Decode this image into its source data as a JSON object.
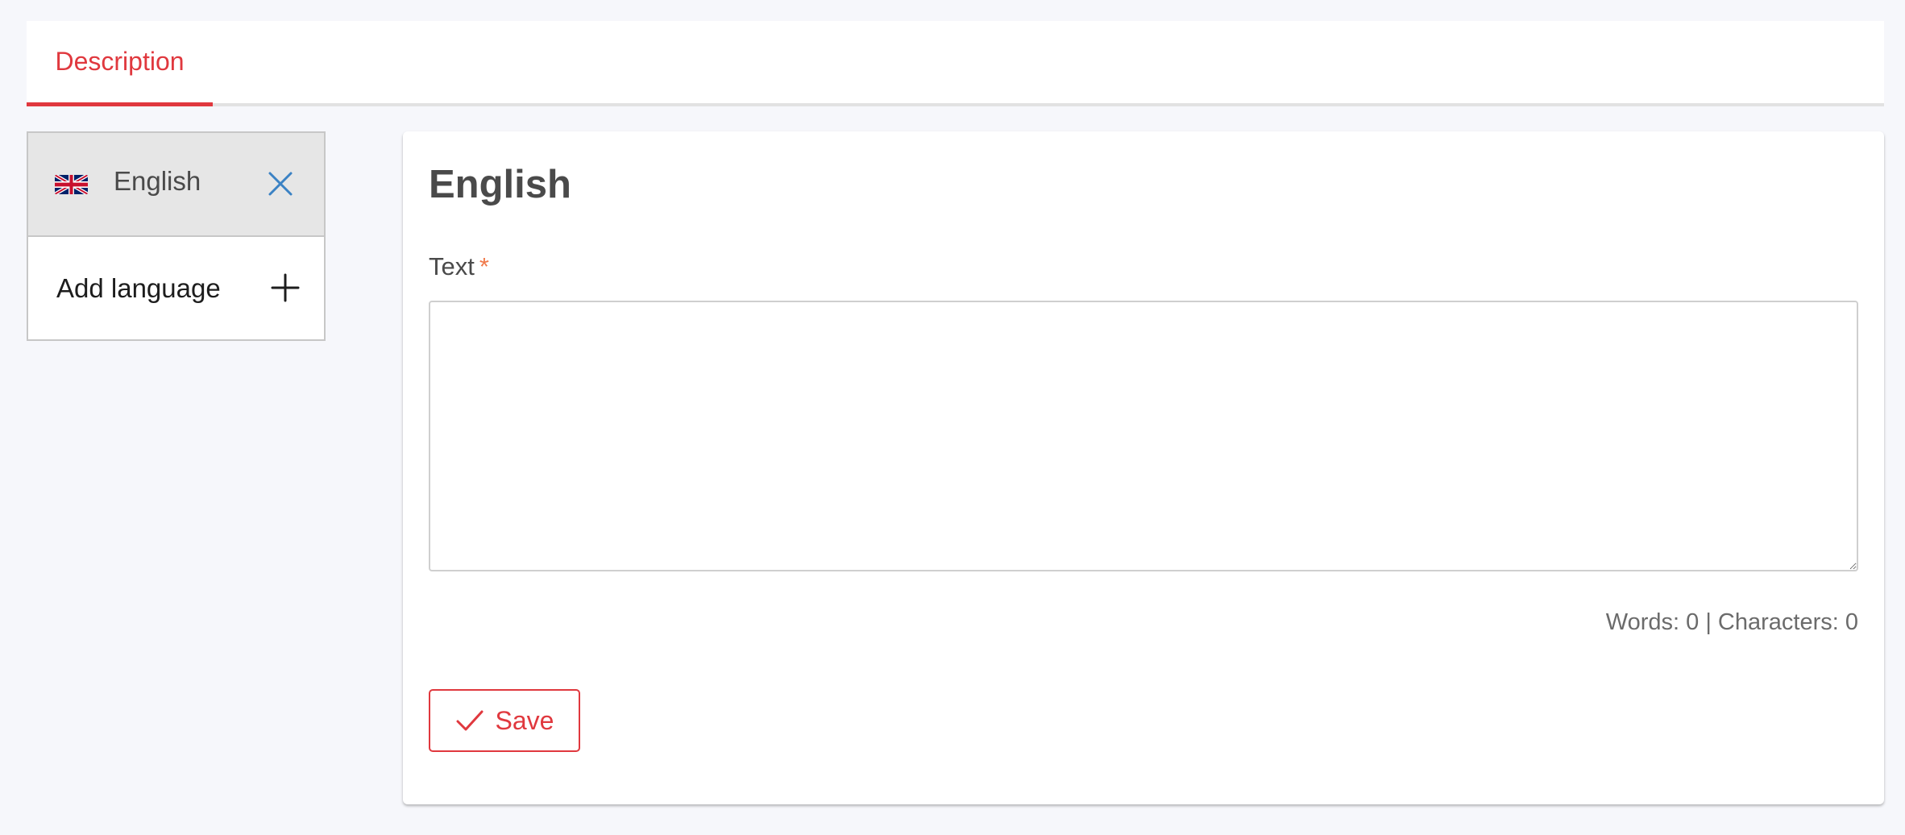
{
  "tabs": [
    {
      "label": "Description",
      "active": true
    }
  ],
  "languages": {
    "items": [
      {
        "label": "English",
        "flag": "uk-flag-icon",
        "selected": true,
        "remove_icon": "close-icon"
      }
    ],
    "add_label": "Add language",
    "add_icon": "plus-icon"
  },
  "editor": {
    "title": "English",
    "field_label": "Text",
    "required_mark": "*",
    "text_value": "",
    "counter": {
      "words_label": "Words: 0",
      "separator": " | ",
      "characters_label": "Characters: 0"
    },
    "save_label": "Save",
    "save_icon": "check-icon"
  },
  "colors": {
    "accent": "#e0383e",
    "remove_icon": "#3b82c4",
    "required": "#f07a4b",
    "background": "#f6f7fb"
  }
}
